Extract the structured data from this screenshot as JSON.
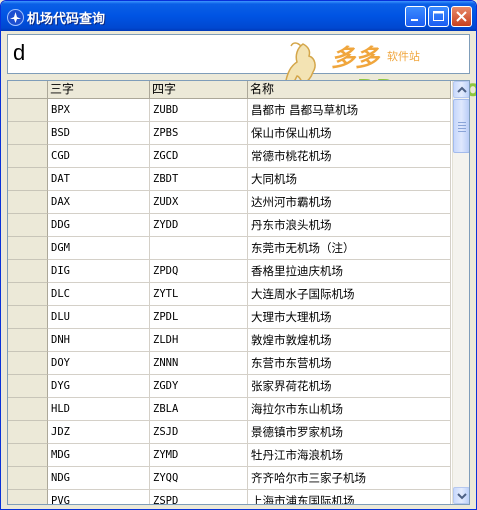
{
  "window": {
    "title": "机场代码查询"
  },
  "search": {
    "value": "d"
  },
  "watermark": {
    "brand": "多多",
    "tagline": "软件站",
    "domain": "DDooo.com"
  },
  "table": {
    "columns": [
      "三字",
      "四字",
      "名称"
    ],
    "rows": [
      [
        "BPX",
        "ZUBD",
        "昌都市 昌都马草机场"
      ],
      [
        "BSD",
        "ZPBS",
        "保山市保山机场"
      ],
      [
        "CGD",
        "ZGCD",
        "常德市桃花机场"
      ],
      [
        "DAT",
        "ZBDT",
        "大同机场"
      ],
      [
        "DAX",
        "ZUDX",
        "达州河市霸机场"
      ],
      [
        "DDG",
        "ZYDD",
        "丹东市浪头机场"
      ],
      [
        "DGM",
        "",
        "东莞市无机场（注）"
      ],
      [
        "DIG",
        "ZPDQ",
        "香格里拉迪庆机场"
      ],
      [
        "DLC",
        "ZYTL",
        "大连周水子国际机场"
      ],
      [
        "DLU",
        "ZPDL",
        "大理市大理机场"
      ],
      [
        "DNH",
        "ZLDH",
        "敦煌市敦煌机场"
      ],
      [
        "DOY",
        "ZNNN",
        "东营市东营机场"
      ],
      [
        "DYG",
        "ZGDY",
        "张家界荷花机场"
      ],
      [
        "HLD",
        "ZBLA",
        "海拉尔市东山机场"
      ],
      [
        "JDZ",
        "ZSJD",
        "景德镇市罗家机场"
      ],
      [
        "MDG",
        "ZYMD",
        "牡丹江市海浪机场"
      ],
      [
        "NDG",
        "ZYQQ",
        "齐齐哈尔市三家子机场"
      ],
      [
        "PVG",
        "ZSPD",
        "上海市浦东国际机场"
      ]
    ]
  },
  "scrollbar": {
    "position_fraction": 0.0
  }
}
